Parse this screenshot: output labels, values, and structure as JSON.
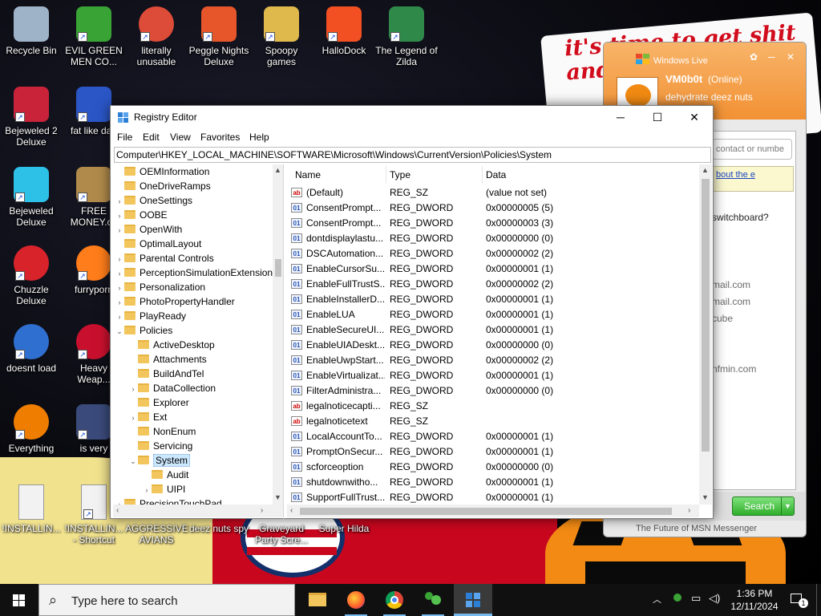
{
  "wallpaper": {
    "slogan": "it's time to get shit and... or t..."
  },
  "desktop_icons": [
    {
      "label": "Recycle Bin",
      "icon": "recycle-bin-icon",
      "color": "#9fb3c8"
    },
    {
      "label": "EVIL GREEN MEN CO...",
      "icon": "msn-people-icon",
      "color": "#3aa335"
    },
    {
      "label": "literally unusable",
      "icon": "chrome-icon",
      "color": "#dd4b39"
    },
    {
      "label": "Peggle Nights Deluxe",
      "icon": "peggle-icon",
      "color": "#e6562a"
    },
    {
      "label": "Spoopy games",
      "icon": "folder-icon",
      "color": "#e0b94c"
    },
    {
      "label": "HalloDock",
      "icon": "windows-logo-icon",
      "color": "#f25022"
    },
    {
      "label": "The Legend of Zilda",
      "icon": "game-character-icon",
      "color": "#2f8a4a"
    },
    {
      "label": "Bejeweled 2 Deluxe",
      "icon": "bejeweled2-icon",
      "color": "#c9233a"
    },
    {
      "label": "fat like darl",
      "icon": "mpl-icon",
      "color": "#2a56c6"
    },
    {
      "label": "Bejeweled Deluxe",
      "icon": "diamond-icon",
      "color": "#2ec1e8"
    },
    {
      "label": "FREE MONEY.co",
      "icon": "money-bag-icon",
      "color": "#b08a4a"
    },
    {
      "label": "Chuzzle Deluxe",
      "icon": "chuzzle-icon",
      "color": "#d8232a"
    },
    {
      "label": "furryporn",
      "icon": "firefox-icon",
      "color": "#ff7d1a"
    },
    {
      "label": "doesnt load",
      "icon": "thunderbird-icon",
      "color": "#2f6fcf"
    },
    {
      "label": "Heavy Weap...",
      "icon": "radiation-icon",
      "color": "#c8102e"
    },
    {
      "label": "Everything",
      "icon": "everything-search-icon",
      "color": "#ef7d00"
    },
    {
      "label": "is very",
      "icon": "shield-icon",
      "color": "#3a4a7a"
    },
    {
      "label": "!INSTALLIN...",
      "icon": "text-file-icon",
      "color": "#f2f2f2"
    },
    {
      "label": "!INSTALLIN... - Shortcut",
      "icon": "text-file-icon",
      "color": "#f2f2f2"
    },
    {
      "label": "AGGRESSIVE AVIANS",
      "icon": "",
      "color": ""
    },
    {
      "label": "deez nuts spy",
      "icon": "",
      "color": ""
    },
    {
      "label": "Graveyard Party Scre...",
      "icon": "",
      "color": ""
    },
    {
      "label": "Super Hilda",
      "icon": "",
      "color": ""
    }
  ],
  "regedit": {
    "title": "Registry Editor",
    "window_controls": {
      "minimize": "─",
      "maximize": "☐",
      "close": "✕"
    },
    "menu": [
      "File",
      "Edit",
      "View",
      "Favorites",
      "Help"
    ],
    "address": "Computer\\HKEY_LOCAL_MACHINE\\SOFTWARE\\Microsoft\\Windows\\CurrentVersion\\Policies\\System",
    "tree": [
      {
        "label": "OEMInformation",
        "expander": "",
        "level": 0
      },
      {
        "label": "OneDriveRamps",
        "expander": "",
        "level": 0
      },
      {
        "label": "OneSettings",
        "expander": ">",
        "level": 0
      },
      {
        "label": "OOBE",
        "expander": ">",
        "level": 0
      },
      {
        "label": "OpenWith",
        "expander": ">",
        "level": 0
      },
      {
        "label": "OptimalLayout",
        "expander": "",
        "level": 0
      },
      {
        "label": "Parental Controls",
        "expander": ">",
        "level": 0
      },
      {
        "label": "PerceptionSimulationExtensions",
        "expander": ">",
        "level": 0
      },
      {
        "label": "Personalization",
        "expander": ">",
        "level": 0
      },
      {
        "label": "PhotoPropertyHandler",
        "expander": ">",
        "level": 0
      },
      {
        "label": "PlayReady",
        "expander": ">",
        "level": 0
      },
      {
        "label": "Policies",
        "expander": "v",
        "level": 0
      },
      {
        "label": "ActiveDesktop",
        "expander": "",
        "level": 1
      },
      {
        "label": "Attachments",
        "expander": "",
        "level": 1
      },
      {
        "label": "BuildAndTel",
        "expander": "",
        "level": 1
      },
      {
        "label": "DataCollection",
        "expander": ">",
        "level": 1
      },
      {
        "label": "Explorer",
        "expander": "",
        "level": 1
      },
      {
        "label": "Ext",
        "expander": ">",
        "level": 1
      },
      {
        "label": "NonEnum",
        "expander": "",
        "level": 1
      },
      {
        "label": "Servicing",
        "expander": "",
        "level": 1
      },
      {
        "label": "System",
        "expander": "v",
        "level": 1,
        "selected": true
      },
      {
        "label": "Audit",
        "expander": "",
        "level": 2
      },
      {
        "label": "UIPI",
        "expander": ">",
        "level": 2
      },
      {
        "label": "PrecisionTouchPad",
        "expander": ">",
        "level": 0
      }
    ],
    "columns": [
      "Name",
      "Type",
      "Data"
    ],
    "values": [
      {
        "name": "(Default)",
        "type": "REG_SZ",
        "data": "(value not set)",
        "kind": "ab"
      },
      {
        "name": "ConsentPrompt...",
        "type": "REG_DWORD",
        "data": "0x00000005 (5)",
        "kind": "01"
      },
      {
        "name": "ConsentPrompt...",
        "type": "REG_DWORD",
        "data": "0x00000003 (3)",
        "kind": "01"
      },
      {
        "name": "dontdisplaylastu...",
        "type": "REG_DWORD",
        "data": "0x00000000 (0)",
        "kind": "01"
      },
      {
        "name": "DSCAutomation...",
        "type": "REG_DWORD",
        "data": "0x00000002 (2)",
        "kind": "01"
      },
      {
        "name": "EnableCursorSu...",
        "type": "REG_DWORD",
        "data": "0x00000001 (1)",
        "kind": "01"
      },
      {
        "name": "EnableFullTrustS...",
        "type": "REG_DWORD",
        "data": "0x00000002 (2)",
        "kind": "01"
      },
      {
        "name": "EnableInstallerD...",
        "type": "REG_DWORD",
        "data": "0x00000001 (1)",
        "kind": "01"
      },
      {
        "name": "EnableLUA",
        "type": "REG_DWORD",
        "data": "0x00000001 (1)",
        "kind": "01"
      },
      {
        "name": "EnableSecureUI...",
        "type": "REG_DWORD",
        "data": "0x00000001 (1)",
        "kind": "01"
      },
      {
        "name": "EnableUIADeskt...",
        "type": "REG_DWORD",
        "data": "0x00000000 (0)",
        "kind": "01"
      },
      {
        "name": "EnableUwpStart...",
        "type": "REG_DWORD",
        "data": "0x00000002 (2)",
        "kind": "01"
      },
      {
        "name": "EnableVirtualizat...",
        "type": "REG_DWORD",
        "data": "0x00000001 (1)",
        "kind": "01"
      },
      {
        "name": "FilterAdministra...",
        "type": "REG_DWORD",
        "data": "0x00000000 (0)",
        "kind": "01"
      },
      {
        "name": "legalnoticecapti...",
        "type": "REG_SZ",
        "data": "",
        "kind": "ab"
      },
      {
        "name": "legalnoticetext",
        "type": "REG_SZ",
        "data": "",
        "kind": "ab"
      },
      {
        "name": "LocalAccountTo...",
        "type": "REG_DWORD",
        "data": "0x00000001 (1)",
        "kind": "01"
      },
      {
        "name": "PromptOnSecur...",
        "type": "REG_DWORD",
        "data": "0x00000001 (1)",
        "kind": "01"
      },
      {
        "name": "scforceoption",
        "type": "REG_DWORD",
        "data": "0x00000000 (0)",
        "kind": "01"
      },
      {
        "name": "shutdownwitho...",
        "type": "REG_DWORD",
        "data": "0x00000001 (1)",
        "kind": "01"
      },
      {
        "name": "SupportFullTrust...",
        "type": "REG_DWORD",
        "data": "0x00000001 (1)",
        "kind": "01"
      }
    ]
  },
  "msn": {
    "brand": "Windows Live",
    "user_name": "VM0b0t",
    "status": "(Online)",
    "personal_message": "dehydrate deez nuts",
    "search_placeholder": "contact or numbe",
    "note_link": "bout the e",
    "question": "switchboard?",
    "contacts": [
      "mail.com",
      "mail.com",
      "cube",
      "nfmin.com"
    ],
    "search_button": "Search",
    "tagline": "The Future of MSN Messenger",
    "accent": "#f29134"
  },
  "taskbar": {
    "search_placeholder": "Type here to search",
    "apps": [
      "file-explorer-icon",
      "firefox-icon",
      "chrome-icon",
      "msn-messenger-icon",
      "regedit-icon"
    ],
    "time": "1:36 PM",
    "date": "12/11/2024",
    "notification_count": "1"
  }
}
